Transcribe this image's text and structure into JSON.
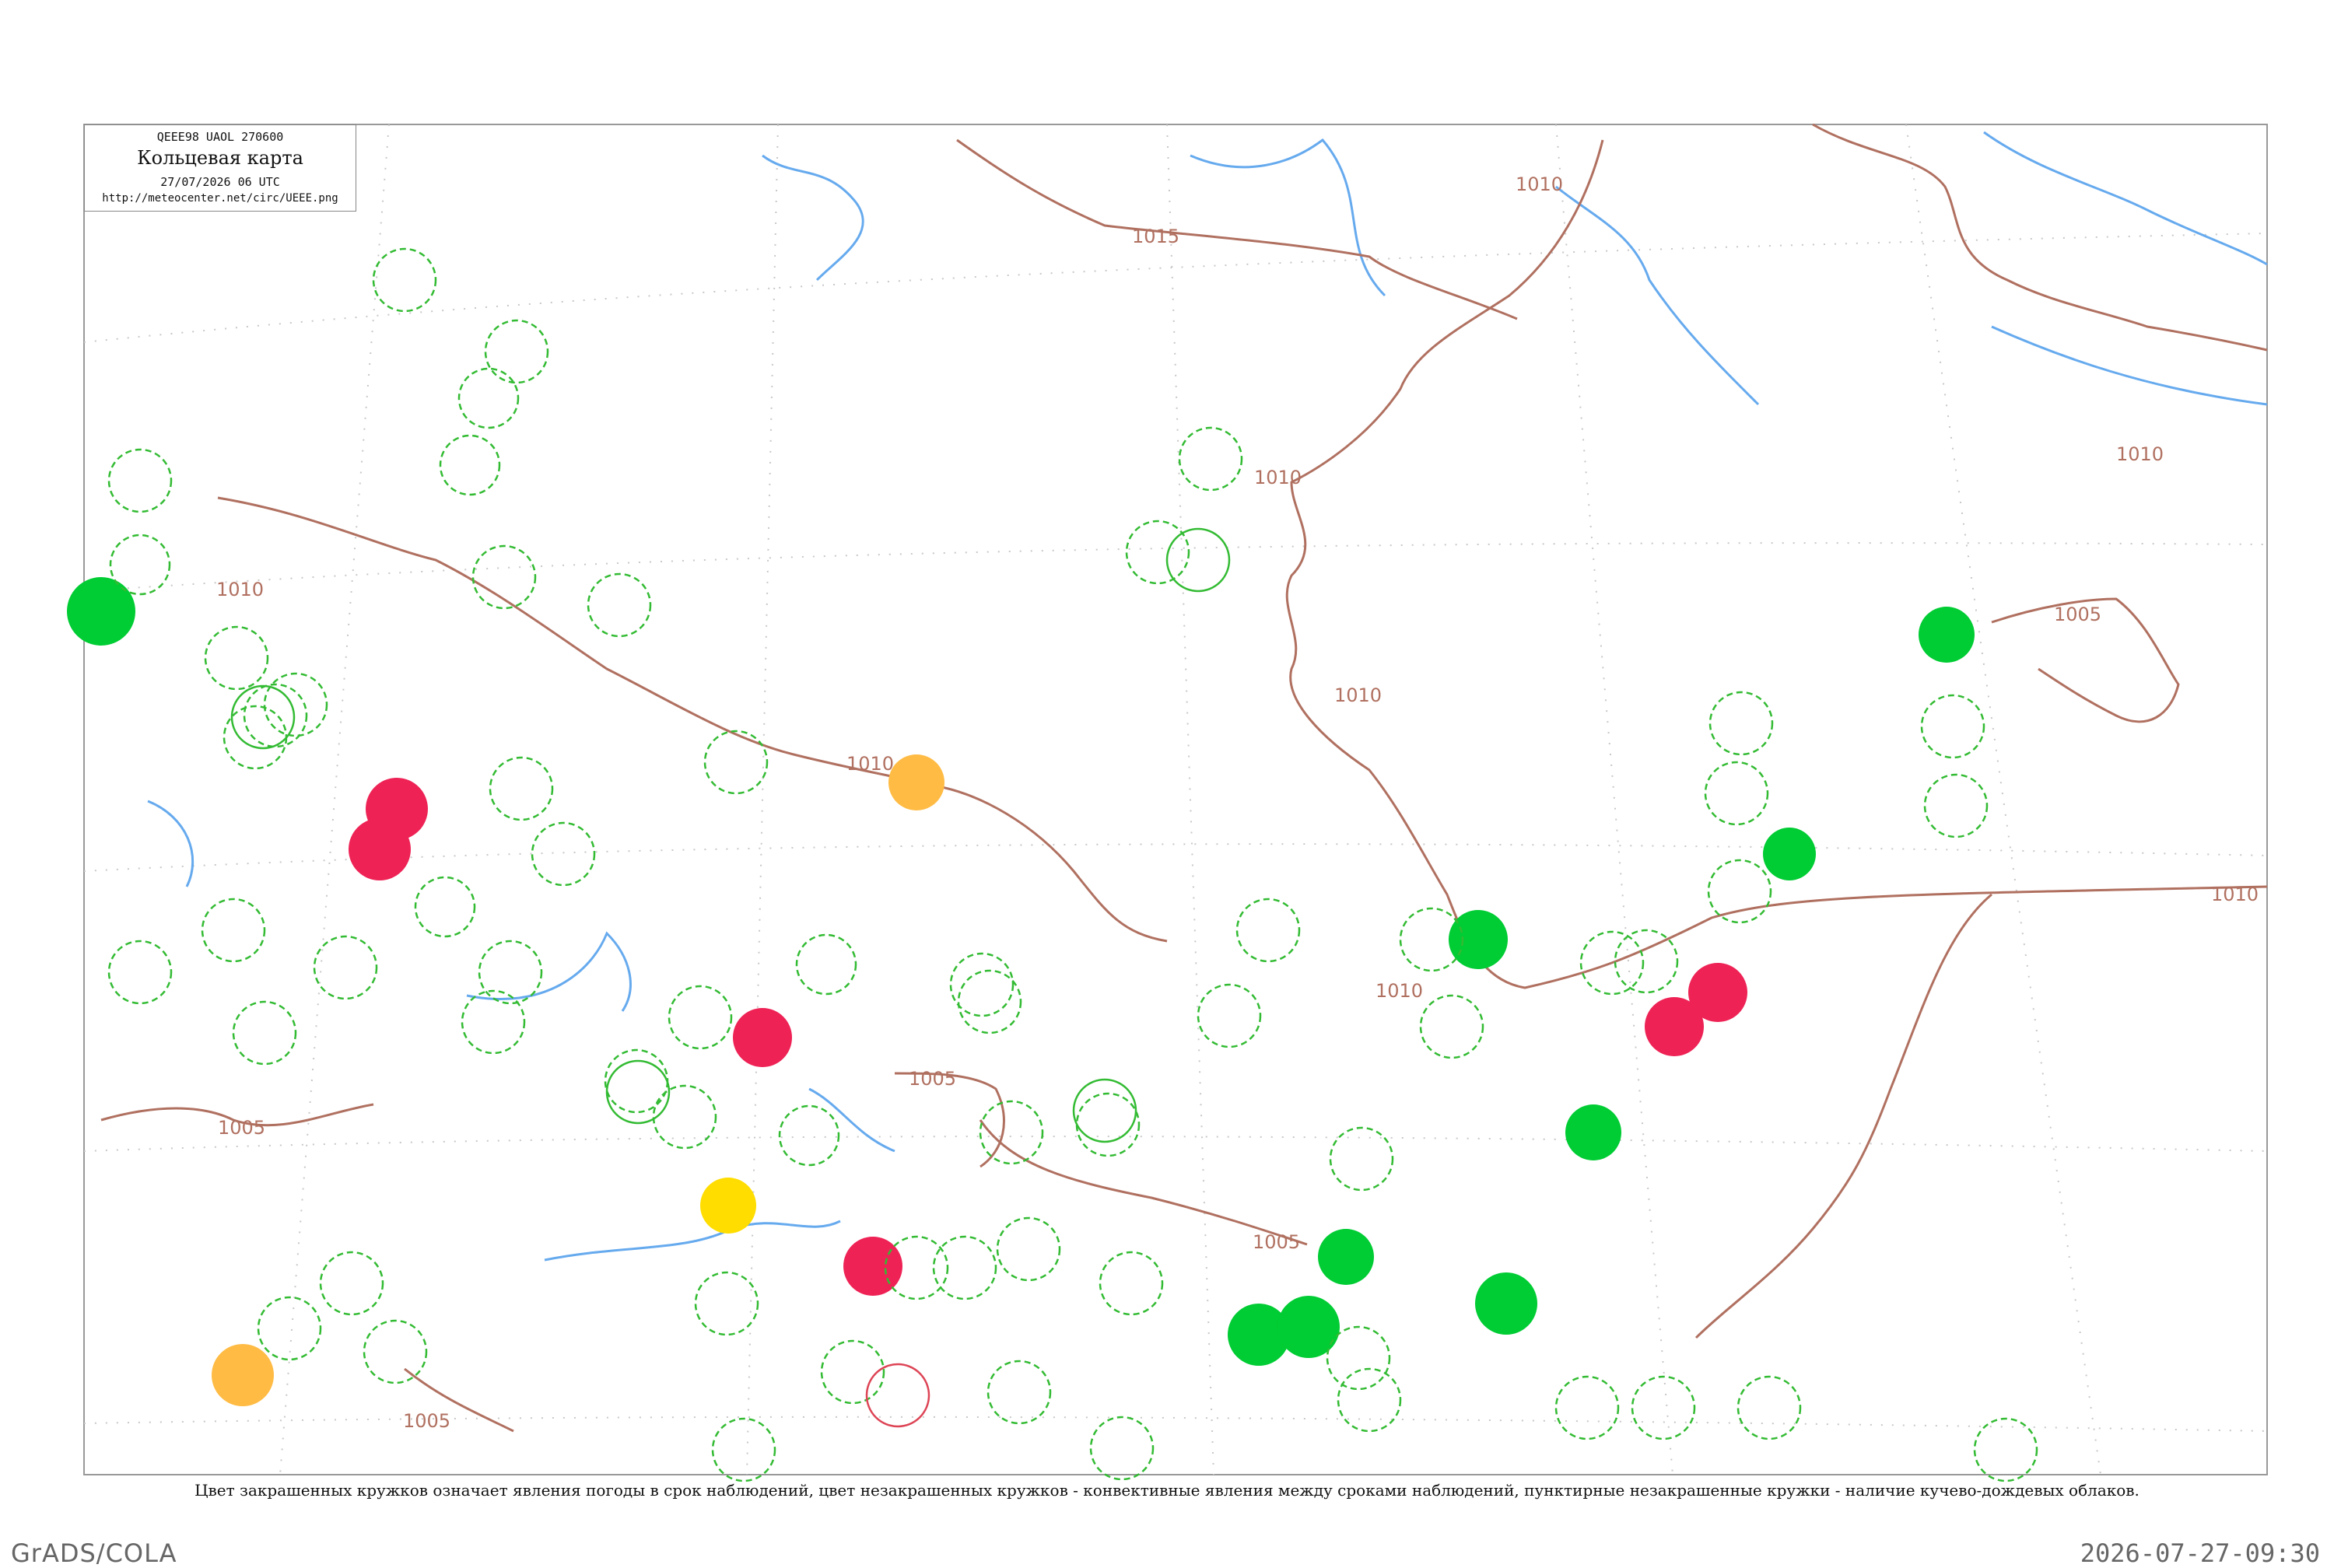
{
  "header": {
    "code_line": "QEEE98  UAOL  270600",
    "title": "Кольцевая карта",
    "datetime": "27/07/2026 06 UTC",
    "url": "http://meteocenter.net/circ/UEEE.png"
  },
  "isobars": [
    {
      "label": "1015"
    },
    {
      "label": "1010"
    },
    {
      "label": "1005"
    }
  ],
  "station_rings": [
    {
      "kind": "filled",
      "color": "#00cc33"
    },
    {
      "kind": "filled",
      "color": "#ee2255"
    },
    {
      "kind": "filled",
      "color": "#ffcc00"
    },
    {
      "kind": "filled",
      "color": "#ffaa33"
    },
    {
      "kind": "dashed",
      "color": "#22aa22"
    }
  ],
  "caption": "Цвет закрашенных кружков означает явления погоды в срок наблюдений, цвет незакрашенных кружков - конвективные явления между сроками наблюдений, пунктирные незакрашенные кружки - наличие кучево-дождевых облаков.",
  "footer": {
    "left": "GrADS/COLA",
    "right": "2026-07-27-09:30"
  },
  "colors": {
    "frame": "#999999",
    "isobar": "#b07060",
    "isobar_label": "#b07060",
    "water": "#66aaee",
    "grid": "#bbbbbb"
  }
}
